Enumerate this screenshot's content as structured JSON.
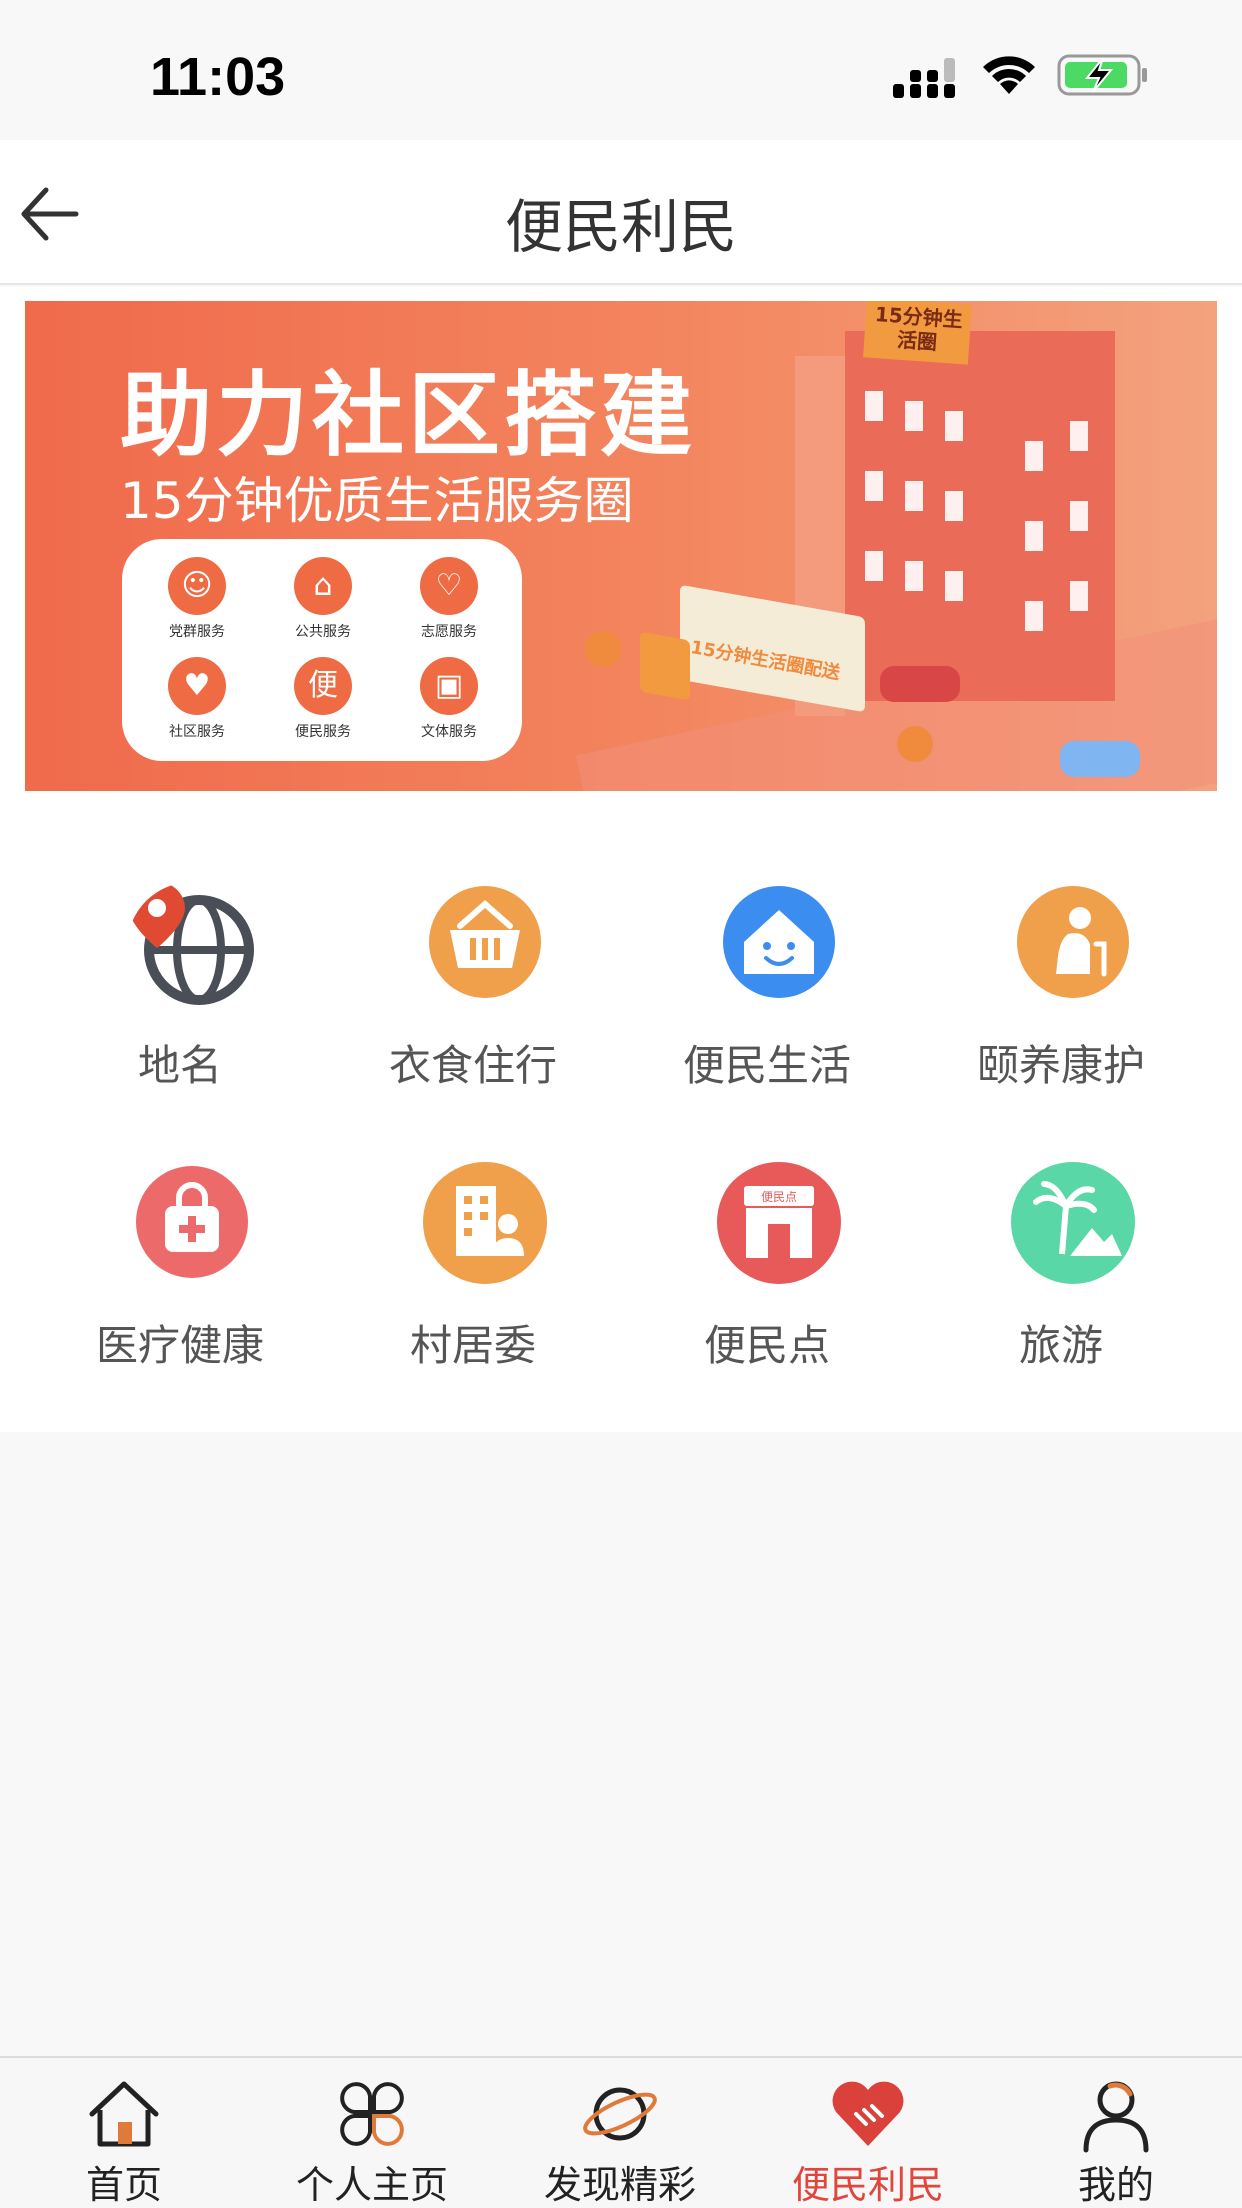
{
  "status_bar": {
    "time": "11:03"
  },
  "nav": {
    "title": "便民利民"
  },
  "banner": {
    "headline": "助力社区搭建",
    "subline": "15分钟优质生活服务圈",
    "card_items": [
      {
        "label": "党群服务",
        "icon": "people-icon"
      },
      {
        "label": "公共服务",
        "icon": "house-hand-icon"
      },
      {
        "label": "志愿服务",
        "icon": "heart-hand-icon"
      },
      {
        "label": "社区服务",
        "icon": "heart-icon"
      },
      {
        "label": "便民服务",
        "icon": "bian-icon"
      },
      {
        "label": "文体服务",
        "icon": "document-icon"
      }
    ],
    "building_sign": "15分钟生活圈",
    "truck_text": "15分钟生活圈配送"
  },
  "services": [
    {
      "label": "地名",
      "icon": "globe-pin-icon",
      "color": "#4a4e57"
    },
    {
      "label": "衣食住行",
      "icon": "basket-icon",
      "color": "#f0a04a"
    },
    {
      "label": "便民生活",
      "icon": "smile-house-icon",
      "color": "#3c8df0"
    },
    {
      "label": "颐养康护",
      "icon": "elder-icon",
      "color": "#f0a04a"
    },
    {
      "label": "医疗健康",
      "icon": "medkit-icon",
      "color": "#ec6a6a"
    },
    {
      "label": "村居委",
      "icon": "building-person-icon",
      "color": "#f0a04a"
    },
    {
      "label": "便民点",
      "icon": "shop-icon",
      "color": "#e85a5a",
      "sign": "便民点"
    },
    {
      "label": "旅游",
      "icon": "palm-mountain-icon",
      "color": "#5ad7a6"
    }
  ],
  "tabs": [
    {
      "label": "首页",
      "icon": "home-icon"
    },
    {
      "label": "个人主页",
      "icon": "clover-icon"
    },
    {
      "label": "发现精彩",
      "icon": "planet-icon"
    },
    {
      "label": "便民利民",
      "icon": "heart-handshake-icon",
      "active": true
    },
    {
      "label": "我的",
      "icon": "user-icon"
    }
  ],
  "colors": {
    "accent": "#e0463b",
    "banner": "#f06a4c"
  }
}
